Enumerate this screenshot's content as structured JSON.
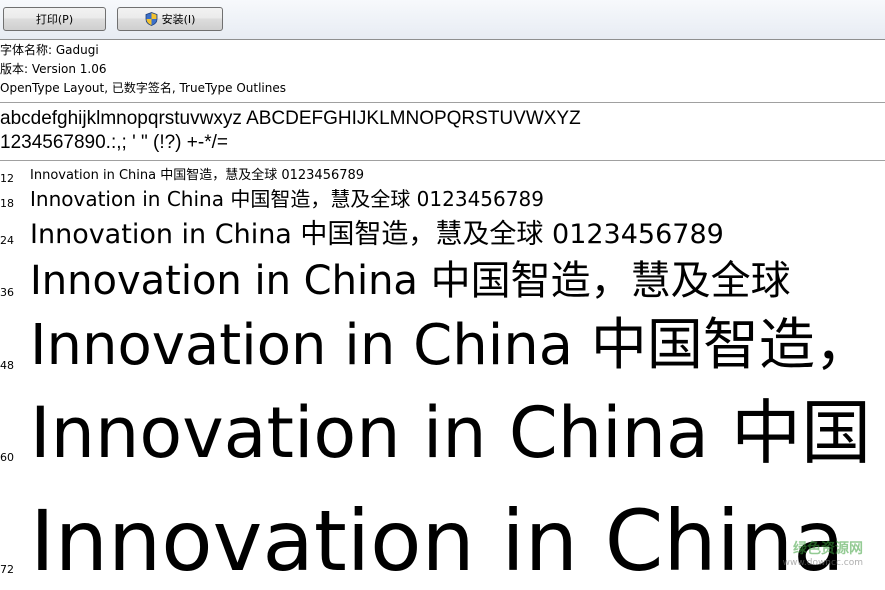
{
  "toolbar": {
    "print_label": "打印(P)",
    "install_label": "安装(I)"
  },
  "info": {
    "font_name": "字体名称: Gadugi",
    "version": "版本: Version 1.06",
    "type": "OpenType Layout, 已数字签名, TrueType Outlines"
  },
  "charset": {
    "line1": "abcdefghijklmnopqrstuvwxyz ABCDEFGHIJKLMNOPQRSTUVWXYZ",
    "line2": "1234567890.:,; ' \" (!?) +-*/="
  },
  "samples": [
    {
      "size": "12",
      "text": "Innovation in China 中国智造，慧及全球 0123456789"
    },
    {
      "size": "18",
      "text": "Innovation in China 中国智造，慧及全球 0123456789"
    },
    {
      "size": "24",
      "text": "Innovation in China 中国智造，慧及全球 0123456789"
    },
    {
      "size": "36",
      "text": "Innovation in China 中国智造，慧及全球"
    },
    {
      "size": "48",
      "text": "Innovation in China 中国智造，"
    },
    {
      "size": "60",
      "text": "Innovation in China 中国"
    },
    {
      "size": "72",
      "text": "Innovation in China"
    }
  ],
  "watermark": {
    "text": "绿色资源网",
    "sub": "www.downcc.com"
  }
}
